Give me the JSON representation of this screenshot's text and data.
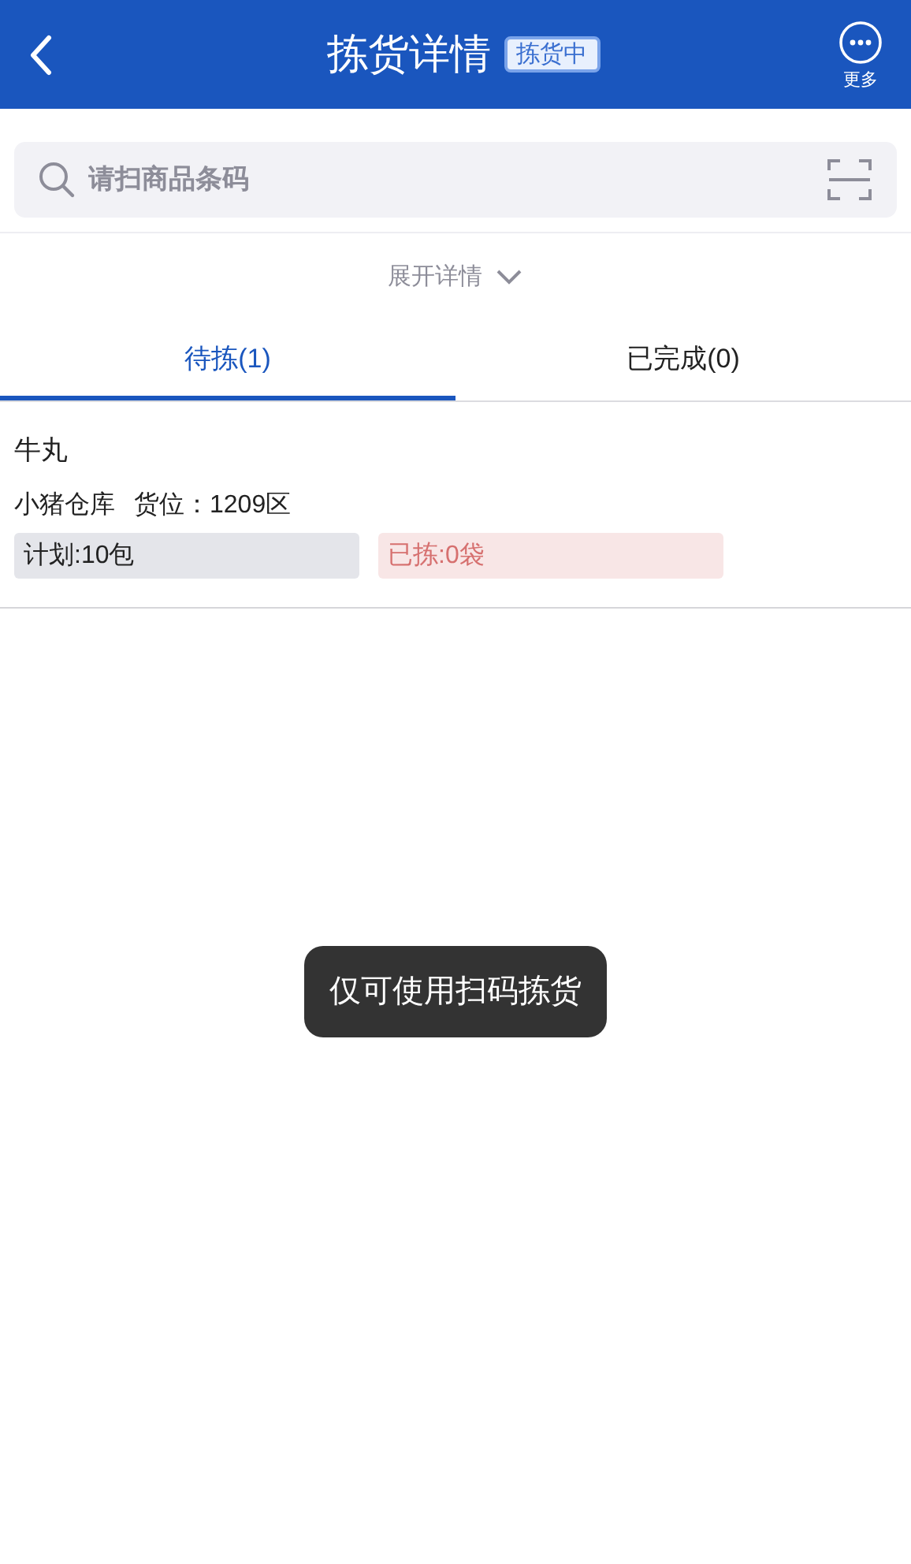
{
  "header": {
    "title": "拣货详情",
    "status_badge": "拣货中",
    "more_label": "更多"
  },
  "search": {
    "placeholder": "请扫商品条码"
  },
  "expand_toggle": {
    "label": "展开详情",
    "expanded": false
  },
  "tabs": [
    {
      "label": "待拣(1)",
      "selected": true
    },
    {
      "label": "已完成(0)",
      "selected": false
    }
  ],
  "items": [
    {
      "name": "牛丸",
      "warehouse": "小猪仓库",
      "location": "货位：1209区",
      "planned": "计划:10包",
      "picked": "已拣:0袋"
    }
  ],
  "toast": "仅可使用扫码拣货"
}
